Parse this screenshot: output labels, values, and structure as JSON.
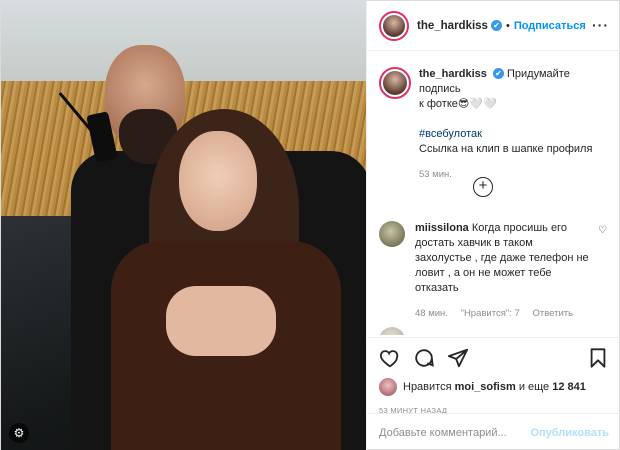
{
  "header": {
    "username": "the_hardkiss",
    "verified_mark": "✔",
    "separator": "•",
    "follow_label": "Подписаться",
    "more_label": "···"
  },
  "caption": {
    "username": "the_hardkiss",
    "text_line1": "Придумайте подпись",
    "text_line2": "к фотке",
    "emoji": "😎🤍🤍",
    "hashtag": "#всебулотак",
    "line3": "Ссылка на клип в шапке профиля",
    "time": "53 мин."
  },
  "load_more_label": "+",
  "comments": [
    {
      "username": "miissilona",
      "text": "Когда просишь его достать хавчик в таком захолустье , где даже телефон не ловит , а он не может тебе отказать",
      "time": "48 мин.",
      "likes": "\"Нравится\": 7",
      "reply_label": "Ответить"
    }
  ],
  "likes": {
    "prefix": "Нравится",
    "user": "moi_sofism",
    "middle": "и еще",
    "count": "12 841"
  },
  "posted_ago": "53 МИНУТ НАЗАД",
  "comment_box": {
    "placeholder": "Добавьте комментарий...",
    "publish_label": "Опубликовать"
  },
  "icons": [
    "heart-icon",
    "comment-icon",
    "share-icon",
    "bookmark-icon",
    "settings-icon"
  ],
  "colors": {
    "accent": "#0095f6",
    "verified": "#3897f0",
    "muted": "#8e8e8e",
    "publish_disabled": "#b2dffc"
  }
}
